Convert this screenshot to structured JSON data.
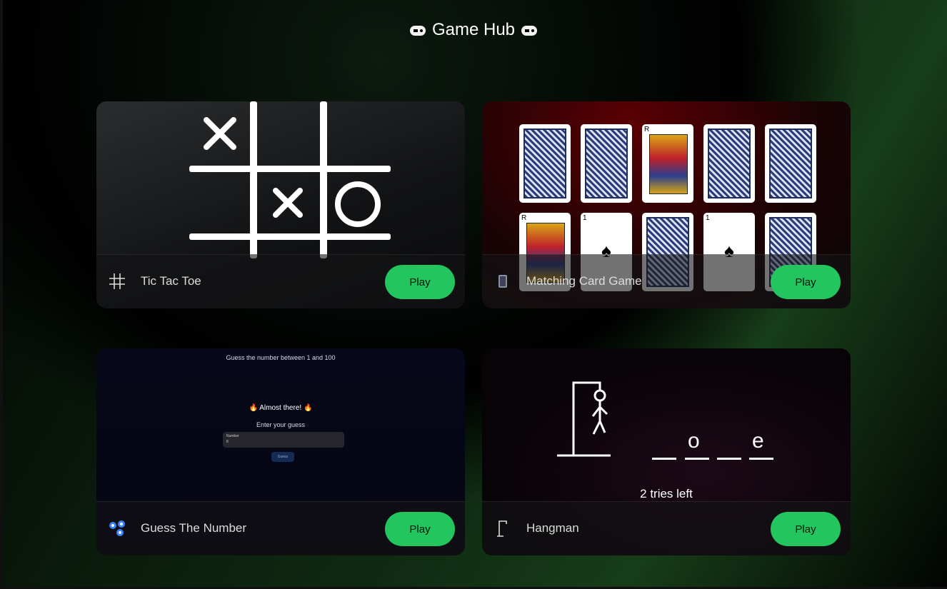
{
  "header": {
    "title": "Game Hub"
  },
  "games": [
    {
      "name": "Tic Tac Toe",
      "play_label": "Play"
    },
    {
      "name": "Matching Card Game",
      "play_label": "Play"
    },
    {
      "name": "Guess The Number",
      "play_label": "Play",
      "preview": {
        "prompt": "Guess the number between 1 and 100",
        "feedback": "🔥 Almost there! 🔥",
        "enter_label": "Enter your guess",
        "input_label": "Number",
        "input_value": "8",
        "button_label": "Guess"
      }
    },
    {
      "name": "Hangman",
      "play_label": "Play",
      "preview": {
        "letter_1": "o",
        "letter_2": "e",
        "tries": "2 tries left"
      }
    }
  ],
  "colors": {
    "play_button": "#22c55e",
    "background": "#0f2a12"
  }
}
